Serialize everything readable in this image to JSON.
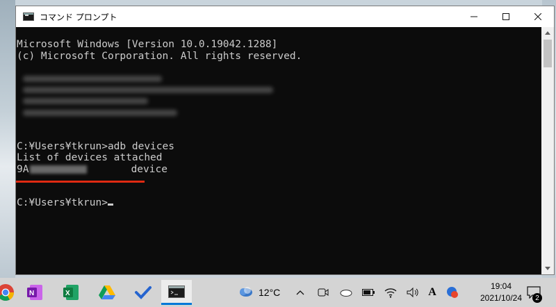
{
  "window": {
    "title": "コマンド プロンプト"
  },
  "console": {
    "lines": [
      "Microsoft Windows [Version 10.0.19042.1288]",
      "(c) Microsoft Corporation. All rights reserved.",
      "C:¥Users¥tkrun>adb devices",
      "List of devices attached",
      "9A",
      "device",
      "C:¥Users¥tkrun>"
    ]
  },
  "taskbar": {
    "apps": [
      {
        "icon": "chrome-icon"
      },
      {
        "icon": "onenote-icon"
      },
      {
        "icon": "excel-icon"
      },
      {
        "icon": "google-drive-icon"
      },
      {
        "icon": "todo-icon"
      },
      {
        "icon": "command-prompt-icon",
        "active": true
      }
    ],
    "weather_temp": "12°C",
    "ime_mode": "A",
    "time": "19:04",
    "date": "2021/10/24",
    "notification_count": "2"
  },
  "colors": {
    "console_bg": "#0c0c0c",
    "console_text": "#cccccc",
    "highlight_underline": "#e02a12",
    "active_app_indicator": "#0078d7"
  }
}
